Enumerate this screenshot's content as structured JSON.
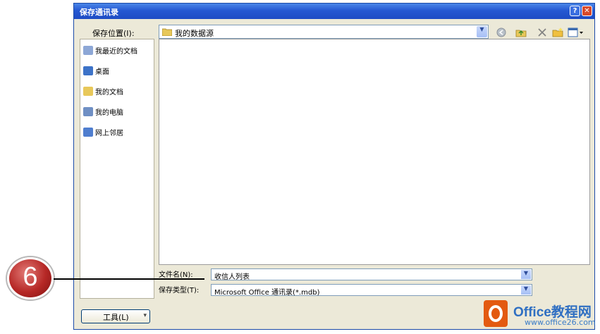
{
  "dialog": {
    "title": "保存通讯录",
    "help_glyph": "?",
    "close_glyph": "✕"
  },
  "location": {
    "label": "保存位置(I):",
    "value": "我的数据源"
  },
  "places": [
    {
      "label": "我最近的文档",
      "icon": "recent-documents-icon",
      "color": "#8da7d6"
    },
    {
      "label": "桌面",
      "icon": "desktop-icon",
      "color": "#3d73c8"
    },
    {
      "label": "我的文档",
      "icon": "my-documents-icon",
      "color": "#e8c85a"
    },
    {
      "label": "我的电脑",
      "icon": "my-computer-icon",
      "color": "#6f8fc4"
    },
    {
      "label": "网上邻居",
      "icon": "network-places-icon",
      "color": "#4f7ecf"
    }
  ],
  "filename": {
    "label": "文件名(N):",
    "value": "收信人列表"
  },
  "filetype": {
    "label": "保存类型(T):",
    "value": "Microsoft Office 通讯录(*.mdb)"
  },
  "tools": {
    "label": "工具(L)"
  },
  "callout": {
    "number": "6"
  },
  "watermark": {
    "brand": "Office教程网",
    "url": "www.office26.com"
  }
}
